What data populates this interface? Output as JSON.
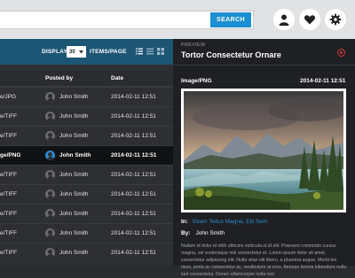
{
  "search": {
    "button_label": "SEARCH",
    "placeholder": ""
  },
  "header_icons": [
    {
      "name": "user-icon"
    },
    {
      "name": "heart-icon"
    },
    {
      "name": "gear-icon"
    }
  ],
  "toolbar": {
    "display_label": "DISPLAY",
    "items_per_page": "30",
    "items_suffix": "ITEMS/PAGE"
  },
  "table": {
    "columns": [
      "Posted by",
      "Date"
    ],
    "rows": [
      {
        "type": "e/JPG",
        "posted_by": "John Smith",
        "date": "2014-02-11 12:51",
        "selected": false
      },
      {
        "type": "e/TIFF",
        "posted_by": "John Smith",
        "date": "2014-02-11 12:51",
        "selected": false
      },
      {
        "type": "e/TIFF",
        "posted_by": "John Smith",
        "date": "2014-02-11 12:51",
        "selected": false
      },
      {
        "type": "ge/PNG",
        "posted_by": "John Smith",
        "date": "2014-02-11 12:51",
        "selected": true
      },
      {
        "type": "e/TIFF",
        "posted_by": "John Smith",
        "date": "2014-02-11 12:51",
        "selected": false
      },
      {
        "type": "e/TIFF",
        "posted_by": "John Smith",
        "date": "2014-02-11 12:51",
        "selected": false
      },
      {
        "type": "e/TIFF",
        "posted_by": "John Smith",
        "date": "2014-02-11 12:51",
        "selected": false
      },
      {
        "type": "e/TIFF",
        "posted_by": "John Smith",
        "date": "2014-02-11 12:51",
        "selected": false
      },
      {
        "type": "e/TIFF",
        "posted_by": "John Smith",
        "date": "2014-02-11 12:51",
        "selected": false
      }
    ]
  },
  "preview": {
    "label": "PREVIEW",
    "title": "Tortor Consectetur Ornare",
    "file_type": "Image/PNG",
    "date": "2014-02-11 12:51",
    "in_label": "In:",
    "in_links": "Etiam Tellus Magna, Elit Sem",
    "by_label": "By:",
    "by_value": "John Smith",
    "description": "Nullam id dolor id nibh ultricies vehicula ut id elit. Praesent commodo cursus magna, vel scelerisque nisl consectetur et. Lorem ipsum dolor sit amet, consectetur adipiscing elit. Nulla vitae elit libero, a pharetra augue. Morbi leo risus, porta ac consectetur ac, vestibulum at eros. Aenean lacinia bibendum nulla sed consectetur. Donec ullamcorper nulla non"
  },
  "colors": {
    "accent": "#1b8fd1",
    "toolbar": "#1d5574",
    "close": "#d0393e"
  }
}
